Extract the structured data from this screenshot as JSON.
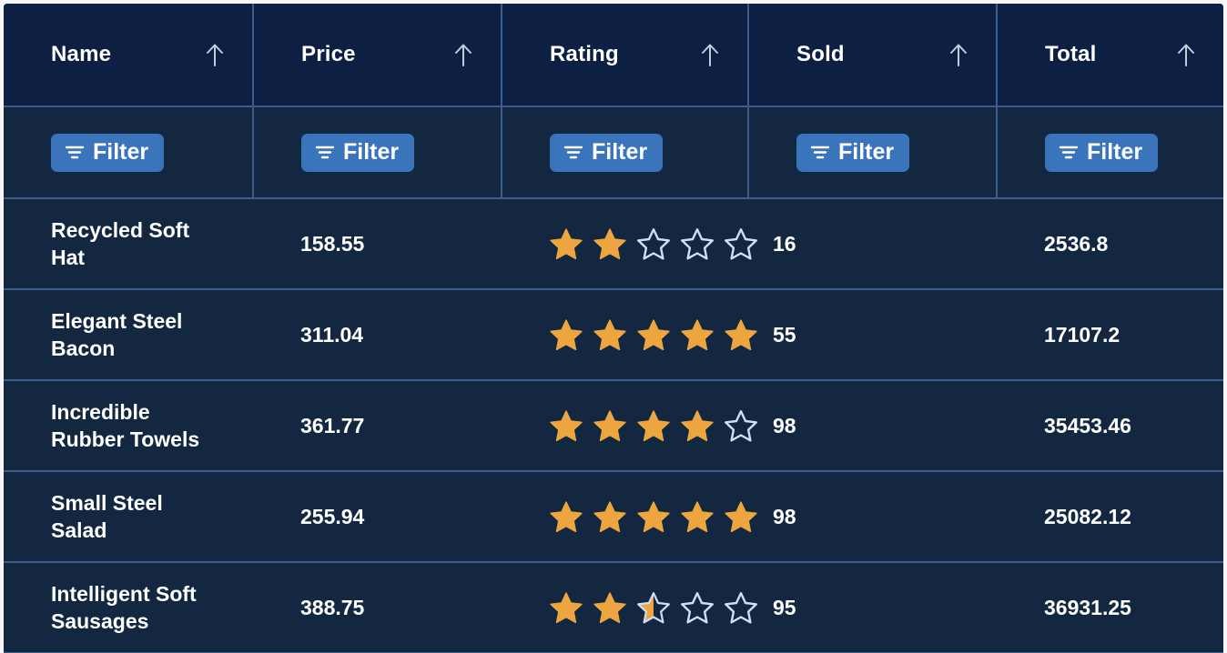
{
  "theme": {
    "header_bg": "#0d1f42",
    "row_bg": "#132840",
    "divider": "#3a5d8f",
    "accent_button": "#3a74bb",
    "star_filled": "#eda63f",
    "star_empty_stroke": "#cfe0f2",
    "text": "#ffffff",
    "page_bg": "#f7f7f7"
  },
  "table": {
    "columns": [
      {
        "key": "name",
        "label": "Name",
        "sort_icon": "arrow-up-icon",
        "filter_label": "Filter",
        "filter_icon": "filter-icon"
      },
      {
        "key": "price",
        "label": "Price",
        "sort_icon": "arrow-up-icon",
        "filter_label": "Filter",
        "filter_icon": "filter-icon"
      },
      {
        "key": "rating",
        "label": "Rating",
        "sort_icon": "arrow-up-icon",
        "filter_label": "Filter",
        "filter_icon": "filter-icon"
      },
      {
        "key": "sold",
        "label": "Sold",
        "sort_icon": "arrow-up-icon",
        "filter_label": "Filter",
        "filter_icon": "filter-icon"
      },
      {
        "key": "total",
        "label": "Total",
        "sort_icon": "arrow-up-icon",
        "filter_label": "Filter",
        "filter_icon": "filter-icon"
      }
    ],
    "rows": [
      {
        "name": "Recycled Soft Hat",
        "price": "158.55",
        "rating": 2,
        "rating_max": 5,
        "sold": "16",
        "total": "2536.8"
      },
      {
        "name": "Elegant Steel Bacon",
        "price": "311.04",
        "rating": 5,
        "rating_max": 5,
        "sold": "55",
        "total": "17107.2"
      },
      {
        "name": "Incredible Rubber Towels",
        "price": "361.77",
        "rating": 4,
        "rating_max": 5,
        "sold": "98",
        "total": "35453.46"
      },
      {
        "name": "Small Steel Salad",
        "price": "255.94",
        "rating": 5,
        "rating_max": 5,
        "sold": "98",
        "total": "25082.12"
      },
      {
        "name": "Intelligent Soft Sausages",
        "price": "388.75",
        "rating": 2.5,
        "rating_max": 5,
        "sold": "95",
        "total": "36931.25"
      }
    ]
  }
}
